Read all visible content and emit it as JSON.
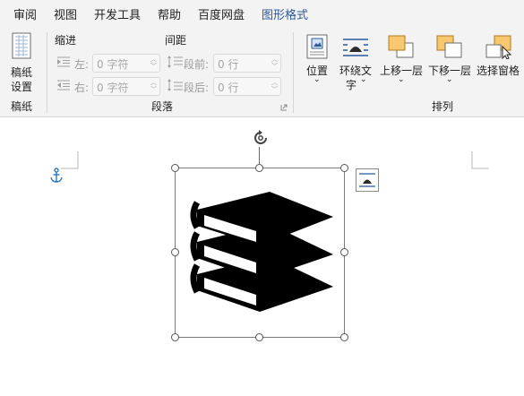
{
  "menu": {
    "tabs": [
      "审阅",
      "视图",
      "开发工具",
      "帮助",
      "百度网盘",
      "图形格式"
    ],
    "active_tab": "图形格式",
    "accent_color": "#2b579a"
  },
  "ribbon": {
    "manuscript": {
      "button_line1": "稿纸",
      "button_line2": "设置",
      "group_label": "稿纸"
    },
    "paragraph": {
      "indent_title": "缩进",
      "spacing_title": "间距",
      "left_label": "左:",
      "left_value": "0 字符",
      "right_label": "右:",
      "right_value": "0 字符",
      "before_label": "段前:",
      "before_value": "0 行",
      "after_label": "段后:",
      "after_value": "0 行",
      "group_label": "段落"
    },
    "arrange": {
      "position_label": "位置",
      "wrap_label_line1": "环绕文",
      "wrap_label_line2": "字",
      "bring_forward_label": "上移一层",
      "send_backward_label": "下移一层",
      "selection_pane_label": "选择窗格",
      "group_label": "排列"
    }
  },
  "document": {
    "image_icon": "stack-of-books-icon",
    "anchor_icon": "anchor-icon",
    "rotate_icon": "rotate-handle-icon",
    "layout_options_icon": "layout-options-icon"
  }
}
